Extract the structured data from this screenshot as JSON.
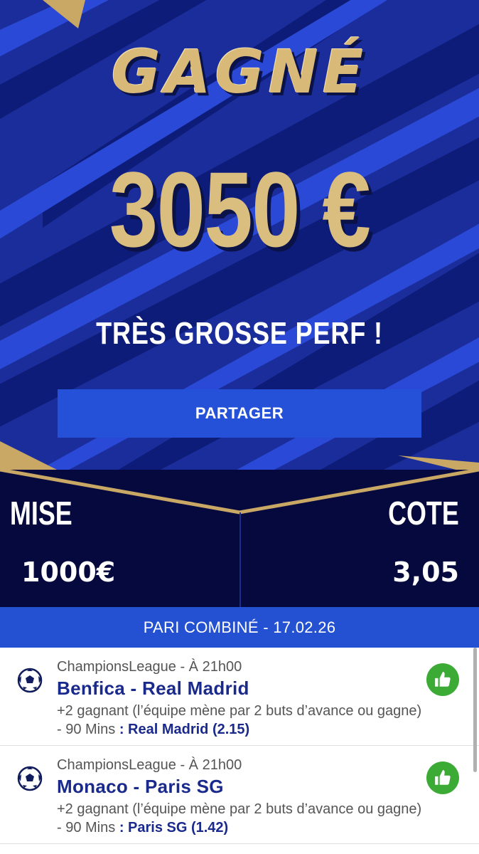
{
  "hero": {
    "title": "GAGNÉ",
    "amount": "3050 €",
    "tagline": "TRÈS GROSSE PERF !",
    "share_label": "PARTAGER"
  },
  "stats": {
    "stake_label": "MISE",
    "stake_value": "1000€",
    "odds_label": "COTE",
    "odds_value": "3,05"
  },
  "combo": {
    "title": "PARI COMBINÉ - 17.02.26"
  },
  "bets": [
    {
      "league": "ChampionsLeague - À 21h00",
      "match": "Benfica - Real Madrid",
      "desc": "+2 gagnant (l’équipe mène par 2 buts d’avance ou gagne) - 90 Mins",
      "selection": ": Real Madrid (2.15)"
    },
    {
      "league": "ChampionsLeague - À 21h00",
      "match": "Monaco - Paris SG",
      "desc": "+2 gagnant (l’équipe mène par 2 buts d’avance ou gagne) - 90 Mins",
      "selection": ": Paris SG (1.42)"
    }
  ],
  "colors": {
    "hero_bg": "#1a2d9a",
    "gold": "#d9be7f",
    "navy": "#06093d",
    "accent_blue": "#2451d2",
    "win_green": "#3cab35",
    "match_text": "#1a2a8c"
  },
  "icons": {
    "sport": "soccer-ball-icon",
    "status": "thumbs-up-icon"
  }
}
